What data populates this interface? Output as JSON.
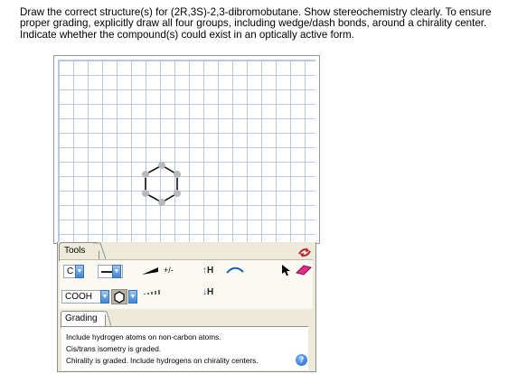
{
  "question": {
    "line1": "Draw the correct structure(s) for (2R,3S)-2,3-dibromobutane. Show stereochemistry clearly. To ensure",
    "line2": "proper grading, explicitly draw all four groups, including wedge/dash bonds, around a chirality center.",
    "line3": "Indicate whether the compound(s) could exist in an optically active form."
  },
  "toolbar": {
    "tab_label": "Tools",
    "element_value": "C",
    "group_value": "COOH",
    "charge_label": "+/-",
    "h_add_label": "H",
    "h_remove_label": "H",
    "clear_icon": "eraser-icon",
    "select_icon": "pointer-arrow-icon",
    "drawing_icon": "undo-redo-icon"
  },
  "grading": {
    "tab_label": "Grading",
    "lines": [
      "Include hydrogen atoms on non-carbon atoms.",
      "Cis/trans isometry is graded.",
      "Chirality is graded. Include hydrogens on chirality centers."
    ],
    "help_icon": "help-question-icon"
  },
  "colors": {
    "grid": "#b6c8e6",
    "panel": "#edeada",
    "accent_blue": "#3d86d4",
    "hex_ring_nodes": "#b9b9b9"
  }
}
